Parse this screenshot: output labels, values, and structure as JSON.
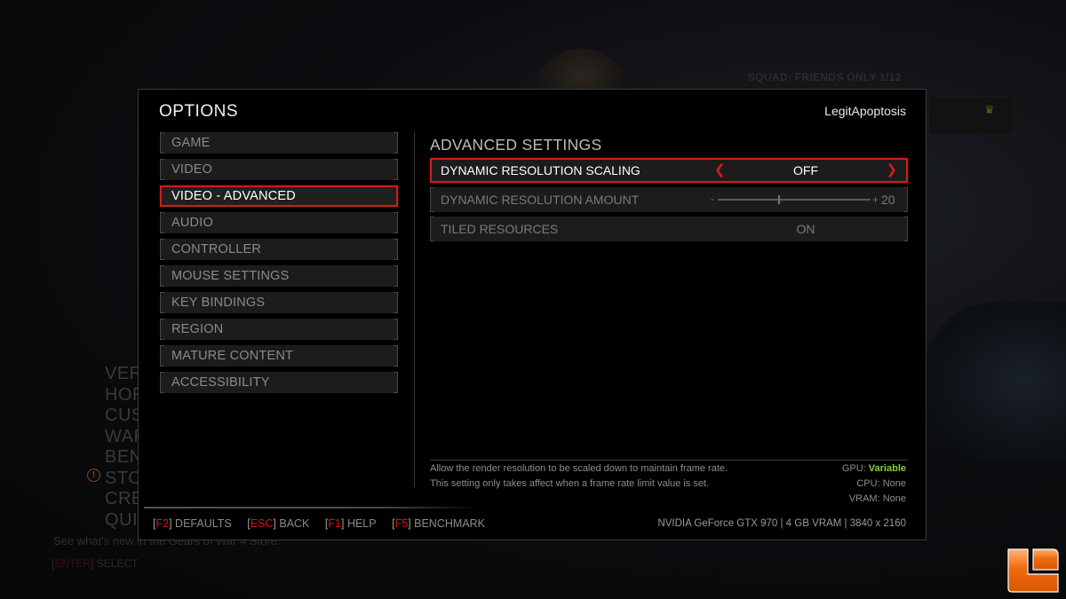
{
  "background": {
    "squad_text": "SQUAD: FRIENDS ONLY 1/12",
    "menu_items": [
      "VER",
      "HOR",
      "CUS",
      "WAR",
      "BEN",
      "STO",
      "CRE",
      "QUI"
    ],
    "store_text": "See what's new in the Gears of War 4 Store.",
    "select_key": "ENTER",
    "select_label": "SELECT"
  },
  "modal": {
    "title": "OPTIONS",
    "username": "LegitApoptosis",
    "nav": {
      "items": [
        {
          "label": "GAME",
          "active": false
        },
        {
          "label": "VIDEO",
          "active": false
        },
        {
          "label": "VIDEO - ADVANCED",
          "active": true
        },
        {
          "label": "AUDIO",
          "active": false
        },
        {
          "label": "CONTROLLER",
          "active": false
        },
        {
          "label": "MOUSE SETTINGS",
          "active": false
        },
        {
          "label": "KEY BINDINGS",
          "active": false
        },
        {
          "label": "REGION",
          "active": false
        },
        {
          "label": "MATURE CONTENT",
          "active": false
        },
        {
          "label": "ACCESSIBILITY",
          "active": false
        }
      ]
    },
    "section_title": "ADVANCED SETTINGS",
    "settings": [
      {
        "label": "DYNAMIC RESOLUTION SCALING",
        "type": "selector",
        "value": "OFF",
        "active": true
      },
      {
        "label": "DYNAMIC RESOLUTION AMOUNT",
        "type": "slider",
        "minus": "-",
        "plus": "+",
        "value": "20",
        "slider_fraction": 0.4,
        "active": false
      },
      {
        "label": "TILED RESOURCES",
        "type": "selector",
        "value": "ON",
        "active": false
      }
    ],
    "description": {
      "line1": "Allow the render resolution to be scaled down to maintain frame rate.",
      "line2": "This setting only takes affect when a frame rate limit value is set."
    },
    "impact": {
      "gpu_label": "GPU:",
      "gpu_value": "Variable",
      "cpu_label": "CPU:",
      "cpu_value": "None",
      "vram_label": "VRAM:",
      "vram_value": "None",
      "good_color": "#7ed13a"
    },
    "footer": {
      "hints": [
        {
          "key": "F2",
          "label": "DEFAULTS"
        },
        {
          "key": "ESC",
          "label": "BACK"
        },
        {
          "key": "F1",
          "label": "HELP"
        },
        {
          "key": "F5",
          "label": "BENCHMARK"
        }
      ],
      "gpu_info": "NVIDIA GeForce GTX 970 | 4 GB VRAM | 3840 x 2160"
    }
  },
  "colors": {
    "accent_red": "#d01c1c",
    "key_red": "#d8141c",
    "logo_orange": "#f06a10"
  }
}
